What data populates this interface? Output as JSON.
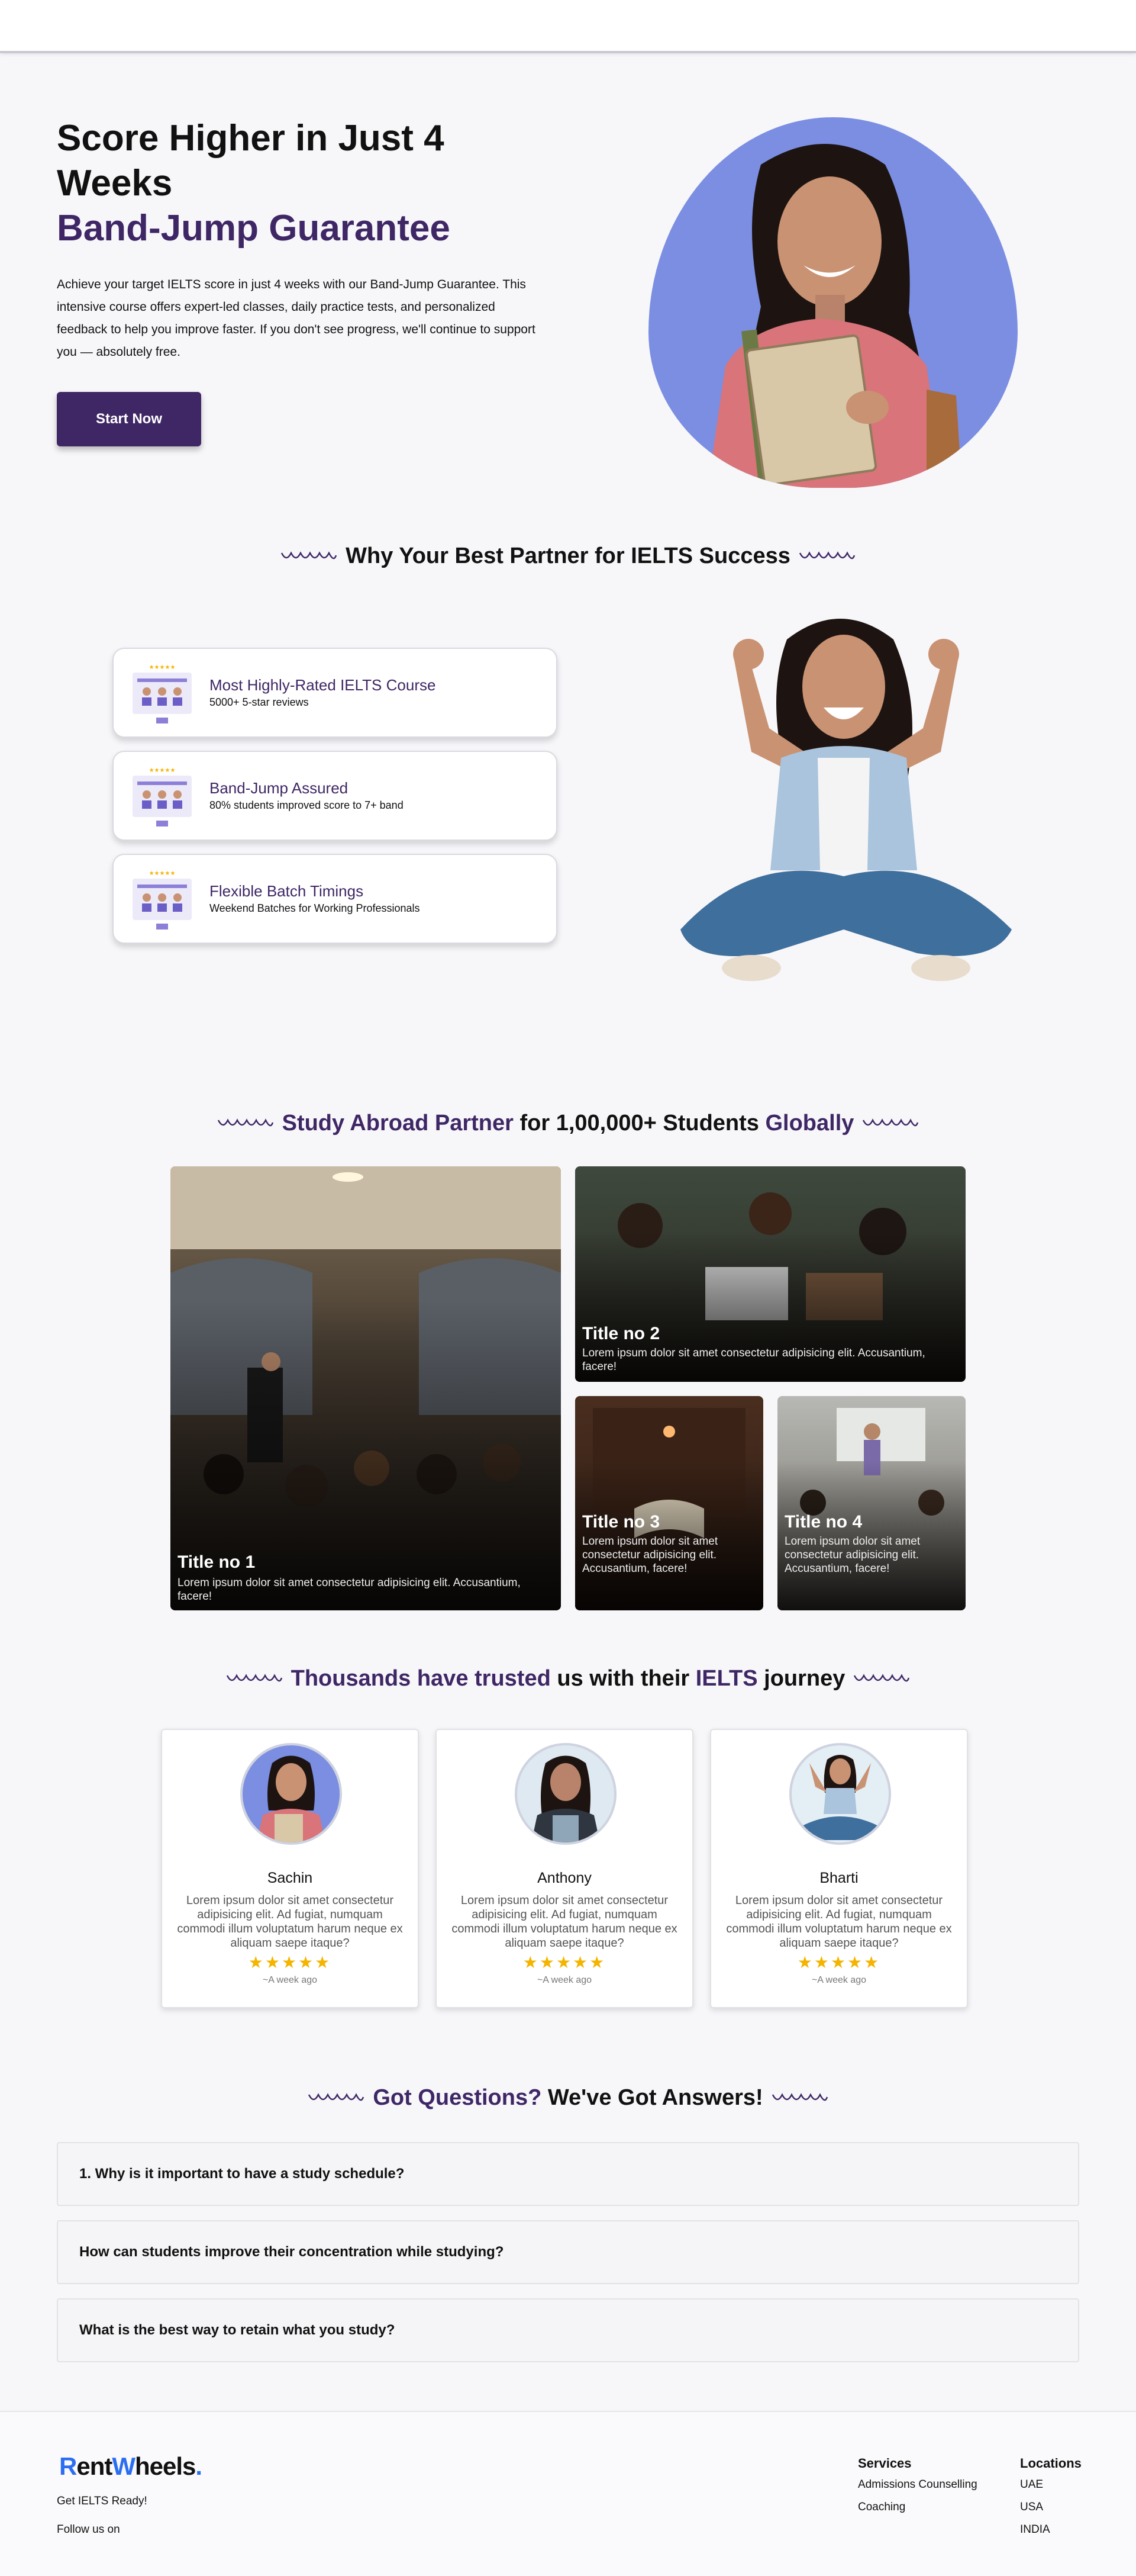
{
  "hero": {
    "title": "Score Higher in Just 4 Weeks",
    "title_accent": "Band-Jump Guarantee",
    "description": "Achieve your target IELTS score in just 4 weeks with our Band-Jump Guarantee. This intensive course offers expert-led classes, daily practice tests, and personalized feedback to help you improve faster. If you don't see progress, we'll continue to support you — absolutely free.",
    "cta": "Start Now"
  },
  "partner": {
    "heading": "Why Your Best Partner for IELTS Success",
    "features": [
      {
        "title": "Most Highly-Rated IELTS Course",
        "subtitle": "5000+ 5-star reviews"
      },
      {
        "title": "Band-Jump Assured",
        "subtitle": "80% students improved score to 7+ band"
      },
      {
        "title": "Flexible Batch Timings",
        "subtitle": "Weekend Batches for Working Professionals"
      }
    ]
  },
  "study": {
    "heading_a": "Study Abroad Partner",
    "heading_b": " for 1,00,000+ Students ",
    "heading_c": "Globally",
    "tiles": [
      {
        "title": "Title no 1",
        "text": "Lorem ipsum dolor sit amet consectetur adipisicing elit. Accusantium, facere!"
      },
      {
        "title": "Title no 2",
        "text": "Lorem ipsum dolor sit amet consectetur adipisicing elit. Accusantium, facere!"
      },
      {
        "title": "Title no 3",
        "text": "Lorem ipsum dolor sit amet consectetur adipisicing elit. Accusantium, facere!"
      },
      {
        "title": "Title no 4",
        "text": "Lorem ipsum dolor sit amet consectetur adipisicing elit. Accusantium, facere!"
      }
    ]
  },
  "trusted": {
    "heading_a": "Thousands have trusted",
    "heading_b": " us with their ",
    "heading_c": "IELTS",
    "heading_d": " journey",
    "reviews": [
      {
        "name": "Sachin",
        "text": "Lorem ipsum dolor sit amet consectetur adipisicing elit. Ad fugiat, numquam commodi illum voluptatum harum neque ex aliquam saepe itaque?",
        "stars": "★★★★★",
        "time": "~A week ago"
      },
      {
        "name": "Anthony",
        "text": "Lorem ipsum dolor sit amet consectetur adipisicing elit. Ad fugiat, numquam commodi illum voluptatum harum neque ex aliquam saepe itaque?",
        "stars": "★★★★★",
        "time": "~A week ago"
      },
      {
        "name": "Bharti",
        "text": "Lorem ipsum dolor sit amet consectetur adipisicing elit. Ad fugiat, numquam commodi illum voluptatum harum neque ex aliquam saepe itaque?",
        "stars": "★★★★★",
        "time": "~A week ago"
      }
    ]
  },
  "faq": {
    "heading_a": "Got Questions?",
    "heading_b": " We've Got Answers!",
    "items": [
      "1. Why is it important to have a study schedule?",
      "How can students improve their concentration while studying?",
      "What is the best way to retain what you study?"
    ]
  },
  "footer": {
    "logo_a": "R",
    "logo_b": "ent",
    "logo_c": "W",
    "logo_d": "heels",
    "logo_e": ".",
    "tagline": "Get IELTS Ready!",
    "follow": "Follow us on",
    "services_heading": "Services",
    "services": [
      "Admissions Counselling",
      "Coaching"
    ],
    "locations_heading": "Locations",
    "locations": [
      "UAE",
      "USA",
      "INDIA"
    ]
  },
  "colors": {
    "accent": "#3f2766",
    "blob": "#7b8ee2",
    "star": "#f4b400",
    "logo_blue": "#2b6ef2"
  }
}
